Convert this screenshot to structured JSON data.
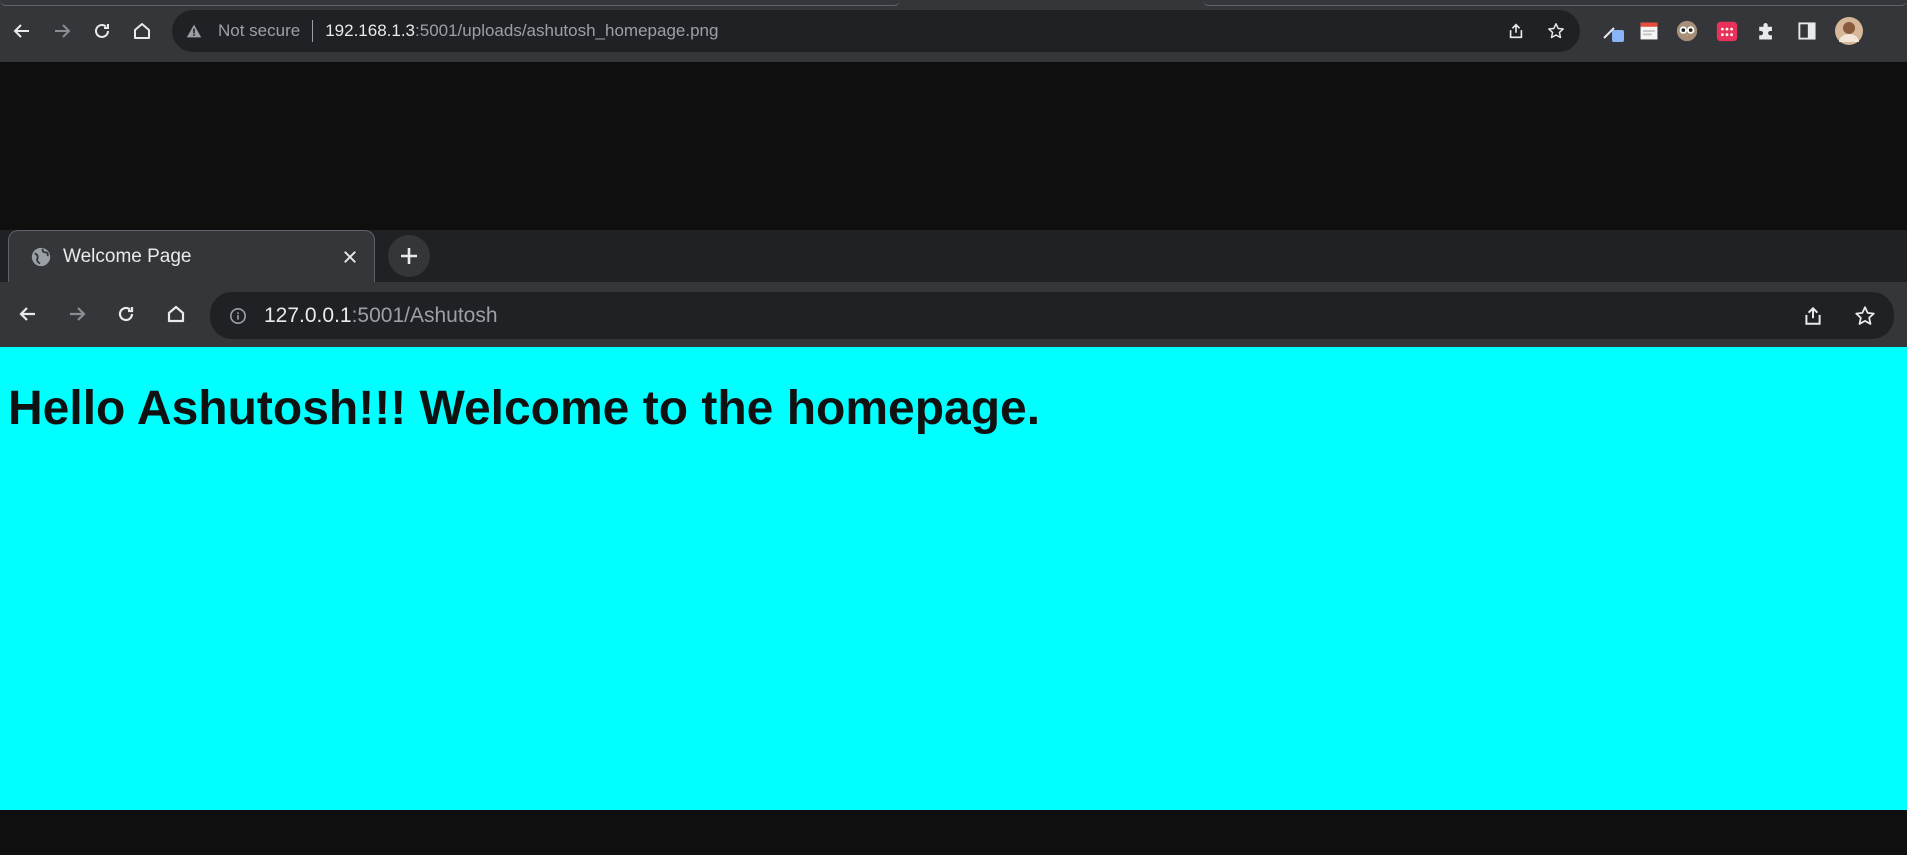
{
  "outer_browser": {
    "omnibox": {
      "security_label": "Not secure",
      "url_host": "192.168.1.3",
      "url_rest": ":5001/uploads/ashutosh_homepage.png"
    },
    "icons": {
      "back": "arrow-left-icon",
      "forward": "arrow-right-icon",
      "reload": "reload-icon",
      "home": "home-icon",
      "warning": "warning-icon",
      "share": "share-icon",
      "bookmark": "star-icon",
      "extensions": [
        "eyedropper-extension-icon",
        "notes-extension-icon",
        "owl-extension-icon",
        "calendar-extension-icon",
        "puzzle-icon",
        "side-panel-icon",
        "profile-avatar"
      ]
    }
  },
  "inner_browser": {
    "tab": {
      "title": "Welcome Page",
      "favicon": "globe-icon"
    },
    "omnibox": {
      "url_host": "127.0.0.1",
      "url_rest": ":5001/Ashutosh"
    }
  },
  "page": {
    "heading": "Hello Ashutosh!!! Welcome to the homepage.",
    "background_color": "#00ffff",
    "text_color": "#111111"
  }
}
